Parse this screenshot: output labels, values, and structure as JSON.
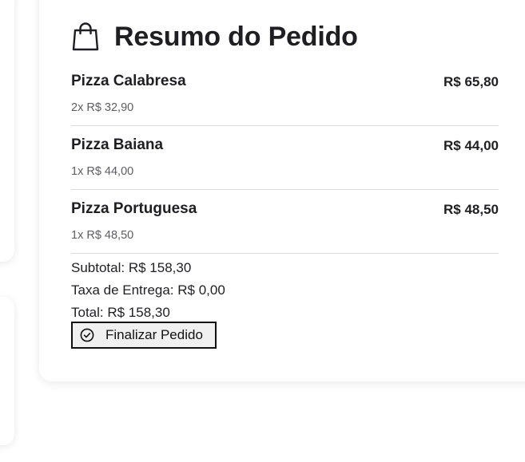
{
  "summary": {
    "title": "Resumo do Pedido",
    "title_icon": "shopping-bag-icon",
    "items": [
      {
        "name": "Pizza Calabresa",
        "quantity_price": "2x R$ 32,90",
        "total": "R$ 65,80"
      },
      {
        "name": "Pizza Baiana",
        "quantity_price": "1x R$ 44,00",
        "total": "R$ 44,00"
      },
      {
        "name": "Pizza Portuguesa",
        "quantity_price": "1x R$ 48,50",
        "total": "R$ 48,50"
      }
    ],
    "subtotal": "Subtotal: R$ 158,30",
    "delivery_fee": "Taxa de Entrega: R$ 0,00",
    "total": "Total: R$ 158,30",
    "finalize_button": {
      "label": "Finalizar Pedido",
      "icon": "check-circle-icon"
    }
  }
}
